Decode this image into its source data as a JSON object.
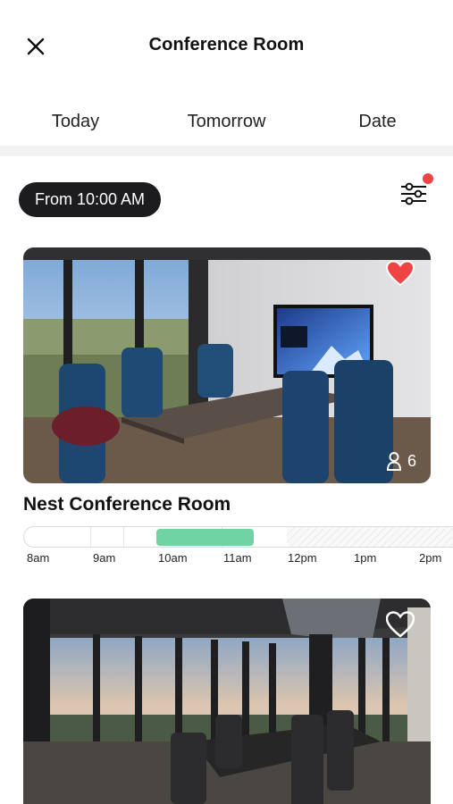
{
  "header": {
    "title": "Conference Room",
    "close_icon": "close-icon"
  },
  "tabs": [
    {
      "label": "Today",
      "selected": false
    },
    {
      "label": "Tomorrow",
      "selected": true
    },
    {
      "label": "Date",
      "selected": false
    }
  ],
  "filters": {
    "time_chip": "From 10:00 AM",
    "filter_icon": "sliders-icon",
    "has_active_filters": true
  },
  "rooms": [
    {
      "name": "Nest Conference Room",
      "capacity": "6",
      "favorite": true,
      "timeline": {
        "labels": [
          "8am",
          "9am",
          "10am",
          "11am",
          "12pm",
          "1pm",
          "2pm"
        ],
        "booked": {
          "from": "10am",
          "to": "11:30am"
        },
        "unavailable_from": "12pm"
      }
    },
    {
      "name": "",
      "favorite": false
    }
  ],
  "colors": {
    "accent": "#1c1c1e",
    "booked": "#6fd3a2",
    "heart_active": "#ef4444",
    "dot": "#ef4444"
  }
}
